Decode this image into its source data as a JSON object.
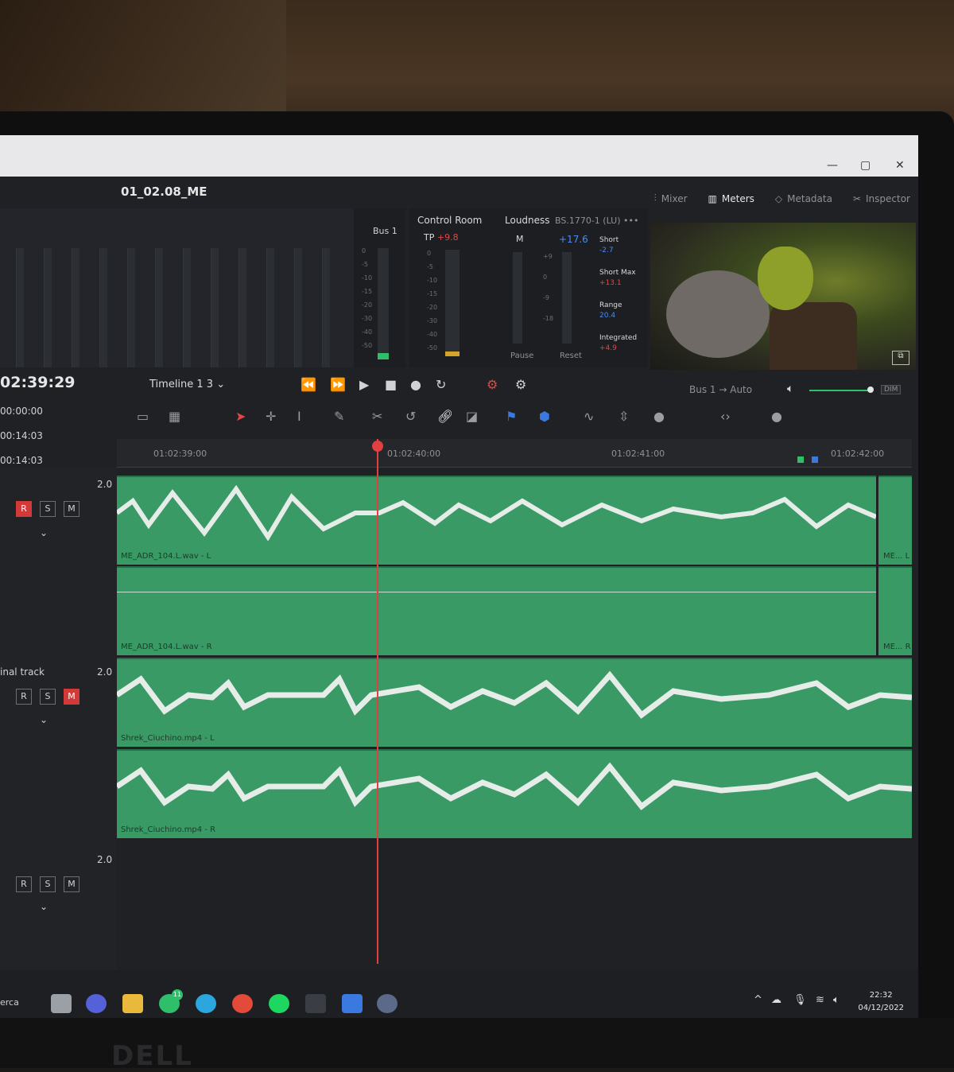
{
  "app": {
    "title": "01_02.08_ME"
  },
  "window": {
    "minimize": "—",
    "maximize": "▢",
    "close": "✕"
  },
  "panels": {
    "mixer": "Mixer",
    "meters": "Meters",
    "metadata": "Metadata",
    "inspector": "Inspector"
  },
  "bus": {
    "label": "Bus 1",
    "scale": [
      "0",
      "-5",
      "-10",
      "-15",
      "-20",
      "-30",
      "-40",
      "-50"
    ]
  },
  "control_room": {
    "title": "Control Room",
    "tp_label": "TP",
    "tp_value": "+9.8",
    "scale": [
      "0",
      "-5",
      "-10",
      "-15",
      "-20",
      "-30",
      "-40",
      "-50"
    ]
  },
  "loudness": {
    "title": "Loudness",
    "standard": "BS.1770-1 (LU)",
    "more": "•••",
    "m_label": "M",
    "m_value": "+17.6",
    "scale": [
      "+9",
      "0",
      "-9",
      "-18"
    ],
    "short_label": "Short",
    "short_value": "-2.7",
    "short_max_label": "Short Max",
    "short_max_value": "+13.1",
    "range_label": "Range",
    "range_value": "20.4",
    "integrated_label": "Integrated",
    "integrated_value": "+4.9",
    "pause": "Pause",
    "reset": "Reset"
  },
  "timecode": {
    "main": "02:39:29",
    "rows": [
      "00:00:00",
      "00:14:03",
      "00:14:03"
    ]
  },
  "timeline": {
    "name": "Timeline 1 3",
    "bus": "Bus 1",
    "auto": "Auto",
    "dim": "DIM"
  },
  "ruler": {
    "ticks": [
      "01:02:39:00",
      "01:02:40:00",
      "01:02:41:00",
      "01:02:42:00"
    ]
  },
  "tracks": [
    {
      "channels": "2.0",
      "name": "",
      "clips": [
        "ME_ADR_104.L.wav - L",
        "ME_ADR_104.L.wav - R"
      ],
      "tail": [
        "ME... L",
        "ME... R"
      ]
    },
    {
      "channels": "2.0",
      "name": "inal track",
      "clips": [
        "Shrek_Ciuchino.mp4 - L",
        "Shrek_Ciuchino.mp4 - R"
      ]
    },
    {
      "channels": "2.0",
      "name": "",
      "clips": []
    }
  ],
  "rsm": {
    "r": "R",
    "s": "S",
    "m": "M"
  },
  "taskbar": {
    "search": "erca",
    "time": "22:32",
    "date": "04/12/2022",
    "whatsapp_badge": "11"
  },
  "colors": {
    "clip_green": "#3a9a66",
    "playhead": "#e04040",
    "accent_blue": "#4a8cf0",
    "record_red": "#d23a3a"
  }
}
